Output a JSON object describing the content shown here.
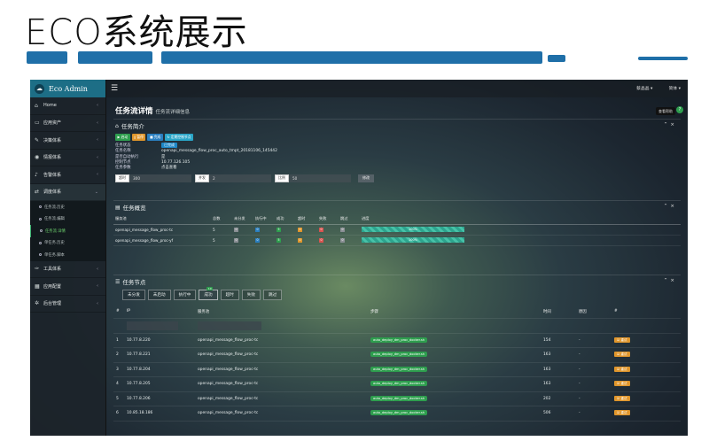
{
  "slide_title": "ECO系统展示",
  "brand": {
    "name": "Eco Admin"
  },
  "sidebar": {
    "items": [
      {
        "label": "Home",
        "icon": "home-icon"
      },
      {
        "label": "应用资产",
        "icon": "monitor-icon"
      },
      {
        "label": "决策体系",
        "icon": "wrench-icon"
      },
      {
        "label": "情报体系",
        "icon": "eye-icon"
      },
      {
        "label": "告警体系",
        "icon": "bell-icon"
      },
      {
        "label": "调度体系",
        "icon": "shuffle-icon"
      }
    ],
    "subitems": [
      "任务流.历史",
      "任务流.编辑",
      "任务流.详情",
      "单任务.历史",
      "单任务.脚本"
    ],
    "active_sub": 2,
    "items_after": [
      {
        "label": "工具体系",
        "icon": "tool-icon"
      },
      {
        "label": "应用配置",
        "icon": "table-icon"
      },
      {
        "label": "后台管理",
        "icon": "cogs-icon"
      }
    ]
  },
  "topbar": {
    "user": "蔡晶晶 ▾",
    "lang": "简体 ▾"
  },
  "page": {
    "title": "任务流详情",
    "subtitle": "任务流详细信息",
    "help_label": "查看帮助",
    "help_icon": "?"
  },
  "summary": {
    "title": "任务简介",
    "buttons": [
      {
        "label": "▶ 启动",
        "color": "#2e9e4e"
      },
      {
        "label": "‖ 暂停",
        "color": "#e0962c"
      },
      {
        "label": "■ 完成",
        "color": "#2a7fc0"
      },
      {
        "label": "↻ 定期控制节点",
        "color": "#2aa6c8"
      }
    ],
    "fields": [
      {
        "k": "任务状态",
        "v": "已完成",
        "badge": true
      },
      {
        "k": "任务名称",
        "v": "openapi_message_flow_proc_auto_tmpt_20181106_145442",
        "badge": false
      },
      {
        "k": "是否自动执行",
        "v": "是",
        "badge": false
      },
      {
        "k": "控制节点",
        "v": "10.77.126.105",
        "badge": false
      },
      {
        "k": "任务参数",
        "v": "点击查看",
        "badge": false
      }
    ],
    "inputs": [
      {
        "label": "超时",
        "value": "300"
      },
      {
        "label": "并发",
        "value": "2"
      },
      {
        "label": "比例",
        "value": "50"
      }
    ],
    "modify_label": "修改"
  },
  "overview": {
    "title": "任务概览",
    "columns": [
      "服务池",
      "总数",
      "未分发",
      "执行中",
      "成功",
      "超时",
      "失败",
      "跳过",
      "进度"
    ],
    "rows": [
      {
        "pool": "openapi_message_flow_proc-tc",
        "total": "5",
        "c1": "0",
        "c2": "0",
        "c3": "5",
        "c4": "0",
        "c5": "0",
        "c6": "0",
        "progress": "100%",
        "progress_value": 100
      },
      {
        "pool": "openapi_message_flow_proc-yf",
        "total": "5",
        "c1": "0",
        "c2": "0",
        "c3": "5",
        "c4": "0",
        "c5": "0",
        "c6": "0",
        "progress": "100%",
        "progress_value": 100
      }
    ],
    "count_colors": [
      "#8a8f94",
      "#2a7fc0",
      "#2e9e4e",
      "#e0962c",
      "#d9534f",
      "#8a8f94"
    ]
  },
  "nodes": {
    "title": "任务节点",
    "tabs": [
      "未分发",
      "未启动",
      "执行中",
      "成功",
      "超时",
      "失败",
      "跳过"
    ],
    "active_tab": 3,
    "active_tab_count": "10",
    "columns": [
      "#",
      "IP",
      "服务池",
      "步骤",
      "时间",
      "原因",
      "#"
    ],
    "rows": [
      {
        "n": "1",
        "ip": "10.77.8.220",
        "pool": "openapi_message_flow_proc-tc",
        "step": "auto_deploy_dm_proc_docker.sh",
        "time": "154",
        "reason": "-",
        "action": "☑ 重试"
      },
      {
        "n": "2",
        "ip": "10.77.8.221",
        "pool": "openapi_message_flow_proc-tc",
        "step": "auto_deploy_dm_proc_docker.sh",
        "time": "163",
        "reason": "-",
        "action": "☑ 重试"
      },
      {
        "n": "3",
        "ip": "10.77.8.204",
        "pool": "openapi_message_flow_proc-tc",
        "step": "auto_deploy_dm_proc_docker.sh",
        "time": "163",
        "reason": "-",
        "action": "☑ 重试"
      },
      {
        "n": "4",
        "ip": "10.77.8.205",
        "pool": "openapi_message_flow_proc-tc",
        "step": "auto_deploy_dm_proc_docker.sh",
        "time": "163",
        "reason": "-",
        "action": "☑ 重试"
      },
      {
        "n": "5",
        "ip": "10.77.8.206",
        "pool": "openapi_message_flow_proc-tc",
        "step": "auto_deploy_dm_proc_docker.sh",
        "time": "202",
        "reason": "-",
        "action": "☑ 重试"
      },
      {
        "n": "6",
        "ip": "10.85.18.186",
        "pool": "openapi_message_flow_proc-tc",
        "step": "auto_deploy_dm_proc_docker.sh",
        "time": "506",
        "reason": "-",
        "action": "☑ 重试"
      }
    ]
  },
  "colors": {
    "brush": "#1f6fa8",
    "brand_bar": "#1d6e86",
    "success": "#2e9e4e",
    "warning": "#e0962c"
  }
}
